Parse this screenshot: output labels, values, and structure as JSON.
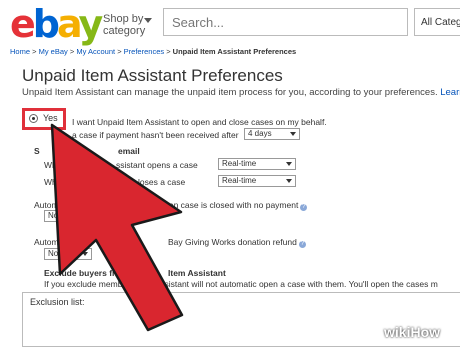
{
  "header": {
    "logo": {
      "e": "e",
      "b": "b",
      "a": "a",
      "y": "y"
    },
    "shop_by_line1": "Shop by",
    "shop_by_line2": "category",
    "search_placeholder": "Search...",
    "all_categories": "All Categ"
  },
  "breadcrumb": {
    "home": "Home",
    "my_ebay": "My eBay",
    "my_account": "My Account",
    "preferences": "Preferences",
    "current": "Unpaid Item Assistant Preferences",
    "sep": " > "
  },
  "page": {
    "title": "Unpaid Item Assistant Preferences",
    "subtitle": "Unpaid Item Assistant can manage the unpaid item process for you, according to your preferences.",
    "learn": "Learn"
  },
  "options": {
    "yes_label": "Yes",
    "yes_text": "I want Unpaid Item Assistant to open and close cases on my behalf.",
    "open_case_text": "a case if payment hasn't been received after",
    "open_case_value": "4 days",
    "email_heading": "S",
    "email_heading_end": "email",
    "when_opens_start": "Wh",
    "when_opens_end": "ssistant opens a case",
    "when_opens_value": "Real-time",
    "when_closes_start": "Whe",
    "when_closes_end": "loses a case",
    "when_closes_value": "Real-time",
    "auto_relist_start": "Autom",
    "auto_relist_end": "when case is closed with no payment",
    "auto_relist_value": "No",
    "auto_request_start": "Automati",
    "auto_request_mid": "eques",
    "auto_request_end": "Bay Giving Works donation refund",
    "auto_request_value": "No",
    "exclude_heading_start": "Exclude buyers from Unp",
    "exclude_heading_end": "Item Assistant",
    "exclude_text": "If you exclude members , the assistant will not automatic open a case with them. You'll open the cases m",
    "exclusion_list_label": "Exclusion list:"
  },
  "watermark": {
    "wiki": "wiki",
    "how": "How"
  },
  "colors": {
    "arrow": "#d9262f",
    "highlight": "#e0303a",
    "link": "#0654ba"
  }
}
